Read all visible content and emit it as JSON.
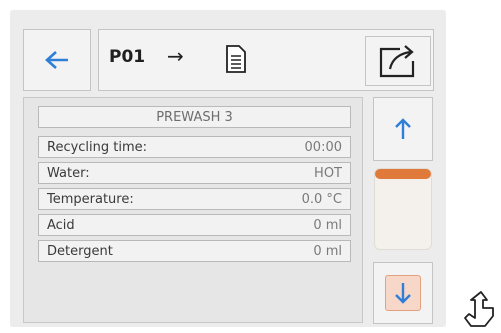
{
  "colors": {
    "accent_blue": "#2f7fd8",
    "scroll_orange": "#e07a3a",
    "panel_bg": "#ececec"
  },
  "header": {
    "back_icon": "arrow-left-icon",
    "program_label": "P01",
    "arrow_symbol": "→",
    "doc_icon": "document-icon",
    "export_icon": "export-icon"
  },
  "list": {
    "header": "PREWASH 3",
    "rows": [
      {
        "label": "Recycling time:",
        "value": "00:00"
      },
      {
        "label": "Water:",
        "value": "HOT"
      },
      {
        "label": "Temperature:",
        "value": "0.0 °C"
      },
      {
        "label": "Acid",
        "value": "0 ml"
      },
      {
        "label": "Detergent",
        "value": "0 ml"
      }
    ]
  },
  "scroll": {
    "up_icon": "arrow-up-icon",
    "down_icon": "arrow-down-icon",
    "position": 0
  },
  "cursor_icon": "hand-pointer-icon"
}
